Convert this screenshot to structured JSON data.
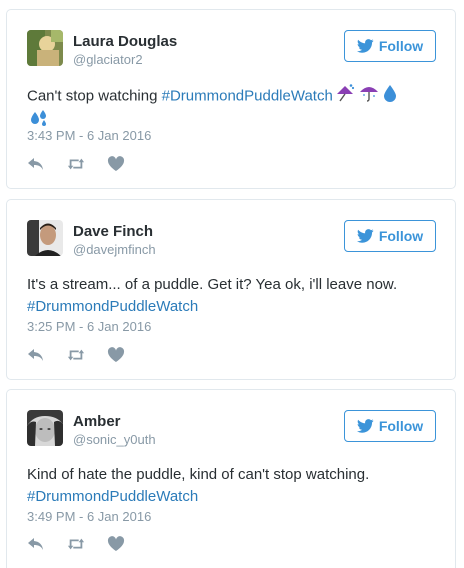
{
  "theme": {
    "text": "#292f33",
    "muted": "#8899a6",
    "link": "#2b7bb9",
    "follow_accent": "#3b94d9",
    "border": "#e1e8ed",
    "action_icon": "#8899a6"
  },
  "icons": {
    "follow": "twitter-bird-icon",
    "reply": "reply-icon",
    "retweet": "retweet-icon",
    "like": "heart-icon",
    "emoji": [
      "umbrella-with-rain-emoji",
      "umbrella-emoji",
      "droplet-emoji",
      "sweat-droplets-emoji"
    ]
  },
  "tweets": [
    {
      "name": "Laura Douglas",
      "handle": "@glaciator2",
      "follow_label": "Follow",
      "text": "Can't stop watching ",
      "hashtag": "#DrummondPuddleWatch",
      "timestamp": "3:43 PM - 6 Jan 2016"
    },
    {
      "name": "Dave Finch",
      "handle": "@davejmfinch",
      "follow_label": "Follow",
      "text": "It's a stream... of a puddle. Get it? Yea ok, i'll leave now.",
      "hashtag": "#DrummondPuddleWatch",
      "timestamp": "3:25 PM - 6 Jan 2016"
    },
    {
      "name": "Amber",
      "handle": "@sonic_y0uth",
      "follow_label": "Follow",
      "text": "Kind of hate the puddle, kind of can't stop watching.",
      "hashtag": "#DrummondPuddleWatch",
      "timestamp": "3:49 PM - 6 Jan 2016"
    }
  ]
}
